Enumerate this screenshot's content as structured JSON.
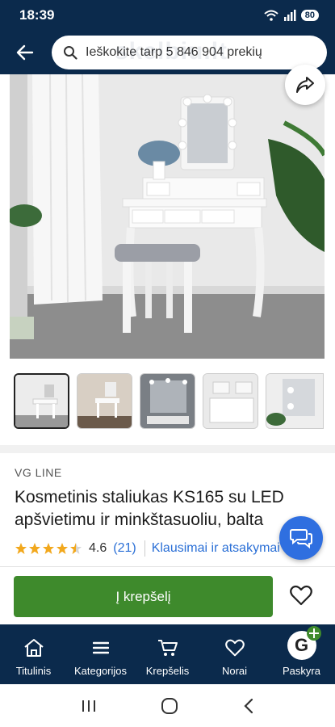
{
  "status": {
    "time": "18:39",
    "battery": "80"
  },
  "search": {
    "placeholder": "Ieškokite tarp 5 846 904 prekių",
    "watermark": "skelbiu.lt"
  },
  "product": {
    "brand": "VG LINE",
    "title_line1": "Kosmetinis staliukas KS165 su LED",
    "title_line2": "apšvietimu ir minkštasuoliu, balta",
    "rating": "4.6",
    "rating_stars": 4.5,
    "reviews": "(21)",
    "questions": "Klausimai ir atsakymai (8)"
  },
  "actions": {
    "add_to_cart": "Į krepšelį"
  },
  "nav": {
    "items": [
      {
        "label": "Titulinis",
        "icon": "home-icon"
      },
      {
        "label": "Kategorijos",
        "icon": "menu-icon"
      },
      {
        "label": "Krepšelis",
        "icon": "cart-icon"
      },
      {
        "label": "Norai",
        "icon": "heart-icon"
      },
      {
        "label": "Paskyra",
        "icon": "avatar"
      }
    ],
    "avatar_initial": "G"
  },
  "colors": {
    "header": "#0b2a4c",
    "cart_button": "#3e8a2c",
    "link": "#2a6fd6",
    "chat": "#2f6fe0"
  }
}
